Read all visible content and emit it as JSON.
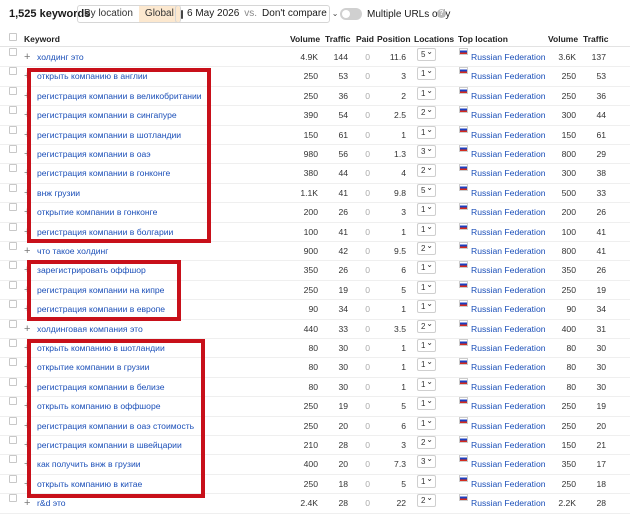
{
  "toolbar": {
    "keyword_count": "1,525 keywords",
    "seg_by_location": "By location",
    "seg_global": "Global",
    "date": "6 May 2026",
    "vs": "vs.",
    "compare": "Don't compare",
    "multiple_urls": "Multiple URLs only"
  },
  "headers": {
    "keyword": "Keyword",
    "volume": "Volume",
    "traffic": "Traffic",
    "paid": "Paid",
    "position": "Position",
    "locations": "Locations",
    "top_location": "Top location",
    "volume2": "Volume",
    "traffic2": "Traffic"
  },
  "rows": [
    {
      "keyword": "холдинг это",
      "volume": "4.9K",
      "traffic": "144",
      "paid": "0",
      "position": "11.6",
      "locations": "5",
      "top_location": "Russian Federation",
      "loc_volume": "3.6K",
      "loc_traffic": "137"
    },
    {
      "keyword": "открыть компанию в англии",
      "volume": "250",
      "traffic": "53",
      "paid": "0",
      "position": "3",
      "locations": "1",
      "top_location": "Russian Federation",
      "loc_volume": "250",
      "loc_traffic": "53"
    },
    {
      "keyword": "регистрация компании в великобритании",
      "volume": "250",
      "traffic": "36",
      "paid": "0",
      "position": "2",
      "locations": "1",
      "top_location": "Russian Federation",
      "loc_volume": "250",
      "loc_traffic": "36"
    },
    {
      "keyword": "регистрация компании в сингапуре",
      "volume": "390",
      "traffic": "54",
      "paid": "0",
      "position": "2.5",
      "locations": "2",
      "top_location": "Russian Federation",
      "loc_volume": "300",
      "loc_traffic": "44"
    },
    {
      "keyword": "регистрация компании в шотландии",
      "volume": "150",
      "traffic": "61",
      "paid": "0",
      "position": "1",
      "locations": "1",
      "top_location": "Russian Federation",
      "loc_volume": "150",
      "loc_traffic": "61"
    },
    {
      "keyword": "регистрация компании в оаэ",
      "volume": "980",
      "traffic": "56",
      "paid": "0",
      "position": "1.3",
      "locations": "3",
      "top_location": "Russian Federation",
      "loc_volume": "800",
      "loc_traffic": "29"
    },
    {
      "keyword": "регистрация компании в гонконге",
      "volume": "380",
      "traffic": "44",
      "paid": "0",
      "position": "4",
      "locations": "2",
      "top_location": "Russian Federation",
      "loc_volume": "300",
      "loc_traffic": "38"
    },
    {
      "keyword": "внж грузии",
      "volume": "1.1K",
      "traffic": "41",
      "paid": "0",
      "position": "9.8",
      "locations": "5",
      "top_location": "Russian Federation",
      "loc_volume": "500",
      "loc_traffic": "33"
    },
    {
      "keyword": "открытие компании в гонконге",
      "volume": "200",
      "traffic": "26",
      "paid": "0",
      "position": "3",
      "locations": "1",
      "top_location": "Russian Federation",
      "loc_volume": "200",
      "loc_traffic": "26"
    },
    {
      "keyword": "регистрация компании в болгарии",
      "volume": "100",
      "traffic": "41",
      "paid": "0",
      "position": "1",
      "locations": "1",
      "top_location": "Russian Federation",
      "loc_volume": "100",
      "loc_traffic": "41"
    },
    {
      "keyword": "что такое холдинг",
      "volume": "900",
      "traffic": "42",
      "paid": "0",
      "position": "9.5",
      "locations": "2",
      "top_location": "Russian Federation",
      "loc_volume": "800",
      "loc_traffic": "41"
    },
    {
      "keyword": "зарегистрировать оффшор",
      "volume": "350",
      "traffic": "26",
      "paid": "0",
      "position": "6",
      "locations": "1",
      "top_location": "Russian Federation",
      "loc_volume": "350",
      "loc_traffic": "26"
    },
    {
      "keyword": "регистрация компании на кипре",
      "volume": "250",
      "traffic": "19",
      "paid": "0",
      "position": "5",
      "locations": "1",
      "top_location": "Russian Federation",
      "loc_volume": "250",
      "loc_traffic": "19"
    },
    {
      "keyword": "регистрация компании в европе",
      "volume": "90",
      "traffic": "34",
      "paid": "0",
      "position": "1",
      "locations": "1",
      "top_location": "Russian Federation",
      "loc_volume": "90",
      "loc_traffic": "34"
    },
    {
      "keyword": "холдинговая компания это",
      "volume": "440",
      "traffic": "33",
      "paid": "0",
      "position": "3.5",
      "locations": "2",
      "top_location": "Russian Federation",
      "loc_volume": "400",
      "loc_traffic": "31"
    },
    {
      "keyword": "открыть компанию в шотландии",
      "volume": "80",
      "traffic": "30",
      "paid": "0",
      "position": "1",
      "locations": "1",
      "top_location": "Russian Federation",
      "loc_volume": "80",
      "loc_traffic": "30"
    },
    {
      "keyword": "открытие компании в грузии",
      "volume": "80",
      "traffic": "30",
      "paid": "0",
      "position": "1",
      "locations": "1",
      "top_location": "Russian Federation",
      "loc_volume": "80",
      "loc_traffic": "30"
    },
    {
      "keyword": "регистрация компании в белизе",
      "volume": "80",
      "traffic": "30",
      "paid": "0",
      "position": "1",
      "locations": "1",
      "top_location": "Russian Federation",
      "loc_volume": "80",
      "loc_traffic": "30"
    },
    {
      "keyword": "открыть компанию в оффшоре",
      "volume": "250",
      "traffic": "19",
      "paid": "0",
      "position": "5",
      "locations": "1",
      "top_location": "Russian Federation",
      "loc_volume": "250",
      "loc_traffic": "19"
    },
    {
      "keyword": "регистрация компании в оаэ стоимость",
      "volume": "250",
      "traffic": "20",
      "paid": "0",
      "position": "6",
      "locations": "1",
      "top_location": "Russian Federation",
      "loc_volume": "250",
      "loc_traffic": "20"
    },
    {
      "keyword": "регистрация компании в швейцарии",
      "volume": "210",
      "traffic": "28",
      "paid": "0",
      "position": "3",
      "locations": "2",
      "top_location": "Russian Federation",
      "loc_volume": "150",
      "loc_traffic": "21"
    },
    {
      "keyword": "как получить внж в грузии",
      "volume": "400",
      "traffic": "20",
      "paid": "0",
      "position": "7.3",
      "locations": "3",
      "top_location": "Russian Federation",
      "loc_volume": "350",
      "loc_traffic": "17"
    },
    {
      "keyword": "открыть компанию в китае",
      "volume": "250",
      "traffic": "18",
      "paid": "0",
      "position": "5",
      "locations": "1",
      "top_location": "Russian Federation",
      "loc_volume": "250",
      "loc_traffic": "18"
    },
    {
      "keyword": "r&d это",
      "volume": "2.4K",
      "traffic": "28",
      "paid": "0",
      "position": "22",
      "locations": "2",
      "top_location": "Russian Federation",
      "loc_volume": "2.2K",
      "loc_traffic": "28"
    }
  ],
  "colors": {
    "highlight": "#c8101a",
    "link": "#1b4fb8",
    "accent": "#fce8cf"
  }
}
